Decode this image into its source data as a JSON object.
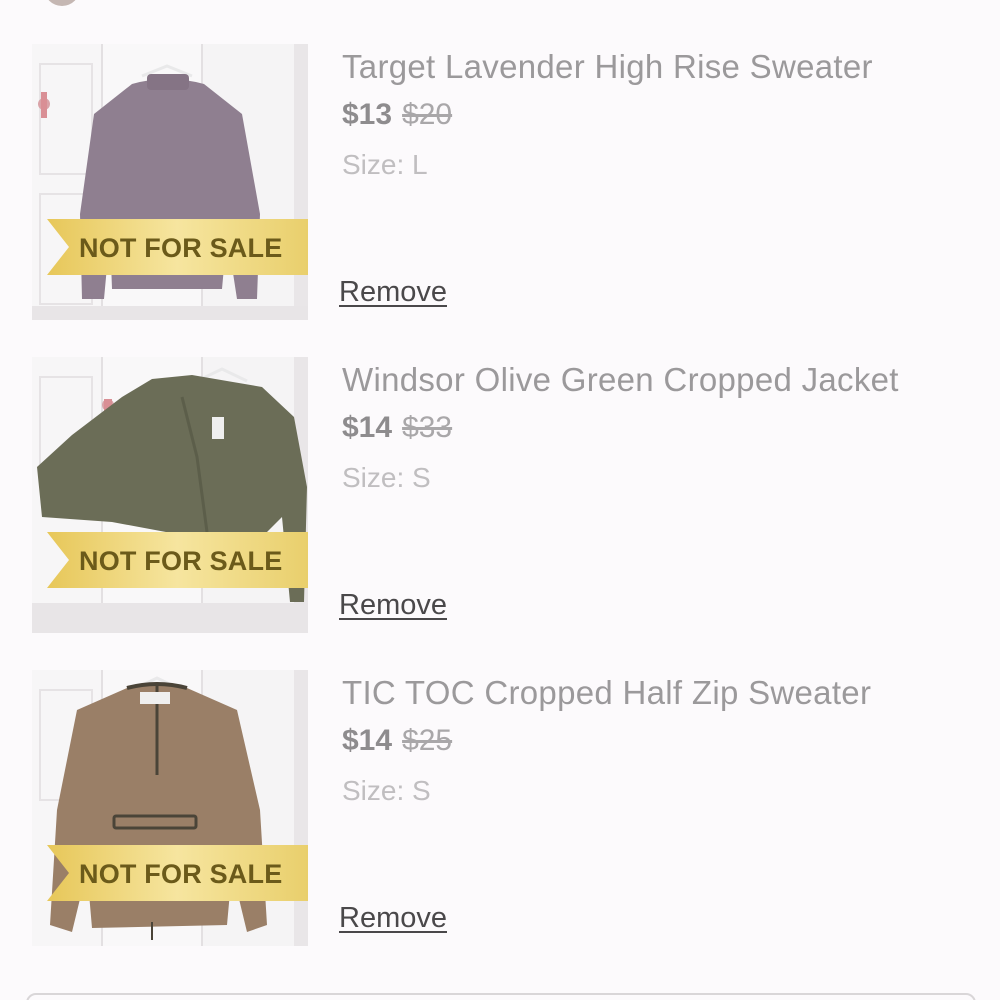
{
  "items": [
    {
      "title": "Target Lavender High Rise Sweater",
      "price": "$13",
      "original_price": "$20",
      "size": "Size: L",
      "badge": "NOT FOR SALE",
      "remove_label": "Remove",
      "colors": {
        "garment": "#8f7f90",
        "hanger": "#f2f2f2"
      }
    },
    {
      "title": "Windsor Olive Green Cropped Jacket",
      "price": "$14",
      "original_price": "$33",
      "size": "Size: S",
      "badge": "NOT FOR SALE",
      "remove_label": "Remove",
      "colors": {
        "garment": "#6b6d57",
        "hanger": "#f2f2f2"
      }
    },
    {
      "title": "TIC TOC Cropped Half Zip Sweater",
      "price": "$14",
      "original_price": "$25",
      "size": "Size: S",
      "badge": "NOT FOR SALE",
      "remove_label": "Remove",
      "colors": {
        "garment": "#9a7f67",
        "hanger": "#f2f2f2"
      }
    }
  ],
  "theme": {
    "background": "#fcfafc",
    "badge_gold": "#f0d87a",
    "badge_text": "#6b5a1a"
  }
}
